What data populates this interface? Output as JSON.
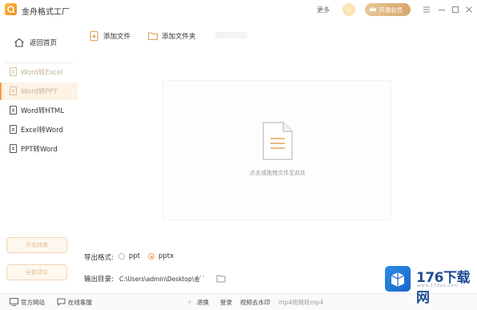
{
  "titlebar": {
    "app_title": "金舟格式工厂",
    "more": "更多",
    "vip_label": "开通会员"
  },
  "sidebar": {
    "back_label": "返回首页",
    "items": [
      {
        "label": "Word转Excel",
        "state": "dim"
      },
      {
        "label": "Word转PPT",
        "state": "active"
      },
      {
        "label": "Word转HTML",
        "state": "normal"
      },
      {
        "label": "Excel转Word",
        "state": "normal"
      },
      {
        "label": "PPT转Word",
        "state": "normal"
      }
    ],
    "buttons": [
      "开始转换",
      "全部清空"
    ]
  },
  "toolbar": {
    "add_file": "添加文件",
    "add_folder": "添加文件夹"
  },
  "main": {
    "drop_hint": "点击或拖拽文件至此处"
  },
  "settings": {
    "export_label": "导出格式:",
    "formats": [
      {
        "label": "ppt",
        "selected": false
      },
      {
        "label": "pptx",
        "selected": true
      }
    ],
    "dir_label": "输出目录:",
    "dir_path": "C:\\Users\\admin\\Desktop\\金",
    "dir_more": "···"
  },
  "statusbar": {
    "website": "官方网站",
    "support": "在线客服",
    "items": [
      "退换",
      "登录",
      "视频去水印",
      "mp4视频转mp4"
    ]
  },
  "watermark": {
    "brand": "176下载网",
    "site": "www.176xz.com"
  },
  "colors": {
    "accent": "#f2a04a",
    "vip_gold": "#d7a66b",
    "active_bg": "#fff3e6"
  }
}
